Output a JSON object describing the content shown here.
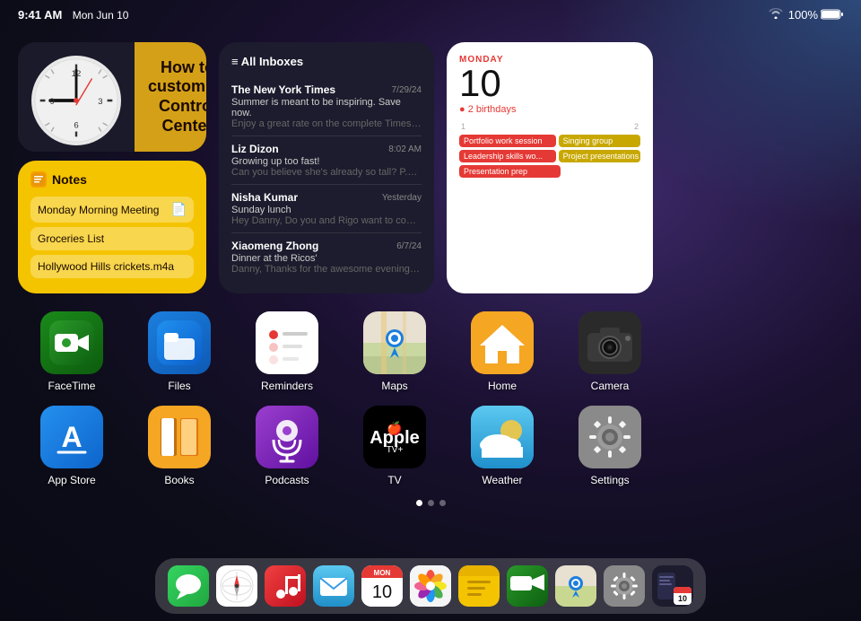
{
  "statusBar": {
    "time": "9:41 AM",
    "date": "Mon Jun 10",
    "wifi": "WiFi",
    "battery": "100%"
  },
  "widgets": {
    "clock": {
      "label": "Clock"
    },
    "controlCenter": {
      "title": "How to customize Control Center"
    },
    "notes": {
      "title": "Notes",
      "items": [
        {
          "text": "Monday Morning Meeting"
        },
        {
          "text": "Groceries List"
        },
        {
          "text": "Hollywood Hills crickets.m4a"
        }
      ]
    },
    "mail": {
      "header": "All Inboxes",
      "items": [
        {
          "sender": "The New York Times",
          "time": "7/29/24",
          "subject": "Summer is meant to be inspiring. Save now.",
          "preview": "Enjoy a great rate on the complete Times experie..."
        },
        {
          "sender": "Liz Dizon",
          "time": "8:02 AM",
          "subject": "Growing up too fast!",
          "preview": "Can you believe she's already so tall? P.S. Thanks..."
        },
        {
          "sender": "Nisha Kumar",
          "time": "Yesterday",
          "subject": "Sunday lunch",
          "preview": "Hey Danny, Do you and Rigo want to come to lun..."
        },
        {
          "sender": "Xiaomeng Zhong",
          "time": "6/7/24",
          "subject": "Dinner at the Ricos'",
          "preview": "Danny, Thanks for the awesome evening! It was s..."
        }
      ]
    },
    "calendar": {
      "dayLabel": "MONDAY",
      "date": "10",
      "birthdays": "● 2 birthdays",
      "columnNumbers": [
        "1",
        "2"
      ],
      "events": [
        {
          "text": "Portfolio work session",
          "color": "red",
          "col": 1
        },
        {
          "text": "Singing group",
          "color": "yellow",
          "col": 2
        },
        {
          "text": "Leadership skills wo...",
          "color": "red",
          "col": 1
        },
        {
          "text": "Project presentations",
          "color": "yellow",
          "col": 2
        },
        {
          "text": "Presentation prep",
          "color": "red",
          "col": 1
        }
      ]
    }
  },
  "apps": {
    "row1": [
      {
        "id": "facetime",
        "label": "FaceTime",
        "iconClass": "icon-facetime",
        "emoji": "📹"
      },
      {
        "id": "files",
        "label": "Files",
        "iconClass": "icon-files",
        "emoji": "🗂"
      },
      {
        "id": "reminders",
        "label": "Reminders",
        "iconClass": "icon-reminders",
        "emoji": "☑"
      },
      {
        "id": "maps",
        "label": "Maps",
        "iconClass": "icon-maps",
        "emoji": "🗺"
      },
      {
        "id": "home",
        "label": "Home",
        "iconClass": "icon-home",
        "emoji": "🏠"
      },
      {
        "id": "camera",
        "label": "Camera",
        "iconClass": "icon-camera",
        "emoji": "📷"
      }
    ],
    "row2": [
      {
        "id": "appstore",
        "label": "App Store",
        "iconClass": "icon-appstore",
        "emoji": "🅰"
      },
      {
        "id": "books",
        "label": "Books",
        "iconClass": "icon-books",
        "emoji": "📚"
      },
      {
        "id": "podcasts",
        "label": "Podcasts",
        "iconClass": "icon-podcasts",
        "emoji": "🎙"
      },
      {
        "id": "tv",
        "label": "TV",
        "iconClass": "icon-tv",
        "emoji": "📺"
      },
      {
        "id": "weather",
        "label": "Weather",
        "iconClass": "icon-weather",
        "emoji": "☁"
      },
      {
        "id": "settings",
        "label": "Settings",
        "iconClass": "icon-settings",
        "emoji": "⚙"
      }
    ]
  },
  "pageDots": [
    {
      "active": true
    },
    {
      "active": false
    },
    {
      "active": false
    }
  ],
  "dock": {
    "items": [
      {
        "id": "messages",
        "iconClass": "icon-messages",
        "emoji": "💬"
      },
      {
        "id": "safari",
        "iconClass": "icon-safari",
        "emoji": "🧭"
      },
      {
        "id": "music",
        "iconClass": "icon-music",
        "emoji": "🎵"
      },
      {
        "id": "mail",
        "iconClass": "icon-mail-dock",
        "emoji": "✉"
      },
      {
        "id": "calendar",
        "iconClass": "icon-calendar",
        "emoji": "📅"
      },
      {
        "id": "photos",
        "iconClass": "icon-photos",
        "emoji": "🌸"
      },
      {
        "id": "notes",
        "iconClass": "icon-notes-dock",
        "emoji": "📋"
      },
      {
        "id": "facetime",
        "iconClass": "icon-facetime-dock",
        "emoji": "📹"
      },
      {
        "id": "maps",
        "iconClass": "icon-maps-dock",
        "emoji": "🗺"
      },
      {
        "id": "settings",
        "iconClass": "icon-settings-dock",
        "emoji": "⚙"
      },
      {
        "id": "reminders",
        "iconClass": "icon-reminder-dock",
        "emoji": "📋"
      }
    ]
  }
}
